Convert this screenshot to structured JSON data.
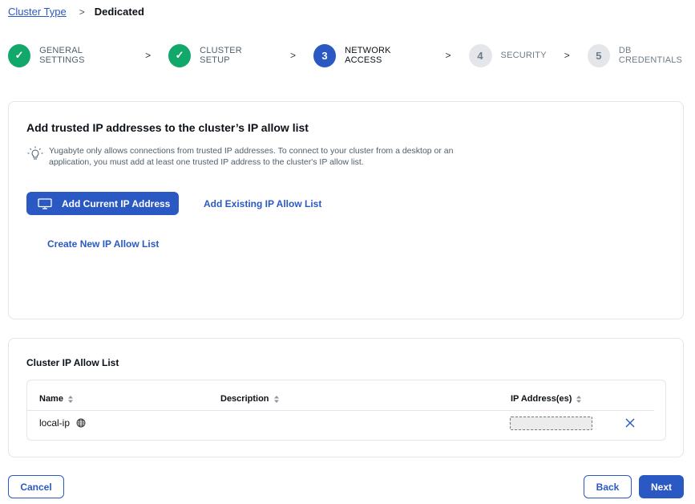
{
  "breadcrumb": {
    "parent": "Cluster Type",
    "separator": ">",
    "current": "Dedicated"
  },
  "steps": [
    {
      "marker": "✓",
      "label": "GENERAL SETTINGS",
      "state": "done"
    },
    {
      "marker": "✓",
      "label": "CLUSTER SETUP",
      "state": "done"
    },
    {
      "marker": "3",
      "label": "NETWORK ACCESS",
      "state": "active"
    },
    {
      "marker": "4",
      "label": "SECURITY",
      "state": "todo"
    },
    {
      "marker": "5",
      "label": "DB CREDENTIALS",
      "state": "todo"
    }
  ],
  "step_separator": ">",
  "ip_section": {
    "title": "Add trusted IP addresses to the cluster’s IP allow list",
    "tip": "Yugabyte only allows connections from trusted IP addresses. To connect to your cluster from a desktop or an application, you must add at least one trusted IP address to the cluster's IP allow list.",
    "add_current_label": "Add Current IP Address",
    "add_existing_label": "Add Existing IP Allow List",
    "create_new_label": "Create New IP Allow List"
  },
  "allow_list": {
    "title": "Cluster IP Allow List",
    "columns": {
      "name": "Name",
      "description": "Description",
      "ip": "IP Address(es)"
    },
    "rows": [
      {
        "name": "local-ip",
        "description": "",
        "ip": ""
      }
    ]
  },
  "footer": {
    "cancel_label": "Cancel",
    "back_label": "Back",
    "next_label": "Next"
  },
  "colors": {
    "accent": "#2b59c3",
    "success": "#13a86b",
    "muted": "#e4e6ea"
  }
}
